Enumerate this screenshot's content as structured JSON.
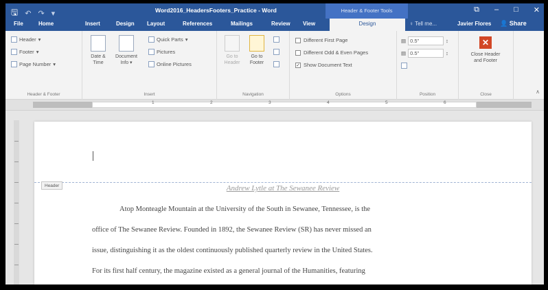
{
  "titlebar": {
    "doc_title": "Word2016_HeadersFooters_Practice - Word",
    "context_label": "Header & Footer Tools"
  },
  "tabs": {
    "file": "File",
    "home": "Home",
    "insert": "Insert",
    "design": "Design",
    "layout": "Layout",
    "references": "References",
    "mailings": "Mailings",
    "review": "Review",
    "view": "View",
    "active_design": "Design"
  },
  "tellme": "Tell me...",
  "user": "Javier Flores",
  "share": "Share",
  "ribbon": {
    "hf_group": {
      "header": "Header",
      "footer": "Footer",
      "page_number": "Page Number",
      "label": "Header & Footer"
    },
    "insert_group": {
      "date_time": [
        "Date &",
        "Time"
      ],
      "doc_info": [
        "Document",
        "Info"
      ],
      "quick_parts": "Quick Parts",
      "pictures": "Pictures",
      "online_pictures": "Online Pictures",
      "label": "Insert"
    },
    "nav_group": {
      "goto_header": [
        "Go to",
        "Header"
      ],
      "goto_footer": [
        "Go to",
        "Footer"
      ],
      "label": "Navigation"
    },
    "options_group": {
      "different_first_page": "Different First Page",
      "different_odd_even": "Different Odd & Even Pages",
      "show_doc_text": "Show Document Text",
      "label": "Options"
    },
    "position_group": {
      "header_from_top": "0.5\"",
      "footer_from_bottom": "0.5\"",
      "label": "Position"
    },
    "close_group": {
      "close": [
        "Close Header",
        "and Footer"
      ],
      "label": "Close"
    }
  },
  "ruler_numbers": [
    "1",
    "2",
    "3",
    "4",
    "5",
    "6"
  ],
  "document": {
    "header_tag": "Header",
    "header_text": "Andrew Lytle at The Sewanee Review",
    "lines": [
      "Atop Monteagle Mountain at the University of the South in Sewanee, Tennessee, is the",
      "office of The Sewanee Review. Founded in 1892, the Sewanee Review (SR) has never missed an",
      "issue, distinguishing it as the oldest continuously published quarterly review in the United States.",
      "For its first half century, the magazine existed as a general journal of the Humanities, featuring"
    ]
  }
}
